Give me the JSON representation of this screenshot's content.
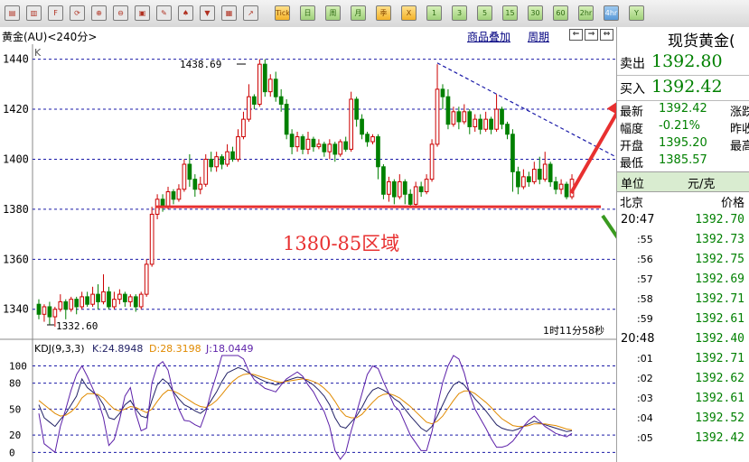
{
  "toolbar": {
    "icons": [
      "chart-icon",
      "book-icon",
      "f10-icon",
      "refresh-icon",
      "zoom-in-icon",
      "zoom-out-icon",
      "window-icon",
      "pen-icon",
      "indicator-icon",
      "filter-icon",
      "table-icon",
      "analysis-icon"
    ],
    "periods": [
      "Tick",
      "日",
      "周",
      "月",
      "季",
      "X",
      "1",
      "3",
      "5",
      "15",
      "30",
      "60",
      "2hr",
      "4hr",
      "Y"
    ],
    "active_period": "4hr"
  },
  "header": {
    "symbol_title": "黄金(AU)<240分>",
    "overlay_link": "商品叠加",
    "period_link": "周期"
  },
  "panel": {
    "title": "现货黄金(",
    "sell_label": "卖出",
    "sell_value": "1392.80",
    "buy_label": "买入",
    "buy_value": "1392.42",
    "stats": [
      {
        "label": "最新",
        "value": "1392.42",
        "label2": "涨跌"
      },
      {
        "label": "幅度",
        "value": "-0.21%",
        "label2": "昨收"
      },
      {
        "label": "开盘",
        "value": "1395.20",
        "label2": "最高"
      },
      {
        "label": "最低",
        "value": "1385.57",
        "label2": ""
      }
    ],
    "unit_label": "单位",
    "unit_value": "元/克",
    "col_city": "北京",
    "col_price": "价格",
    "ticks": [
      {
        "time": "20:47",
        "price": "1392.70"
      },
      {
        "time": ":55",
        "price": "1392.73"
      },
      {
        "time": ":56",
        "price": "1392.75"
      },
      {
        "time": ":57",
        "price": "1392.69"
      },
      {
        "time": ":58",
        "price": "1392.71"
      },
      {
        "time": ":59",
        "price": "1392.61"
      },
      {
        "time": "20:48",
        "price": "1392.40"
      },
      {
        "time": ":01",
        "price": "1392.71"
      },
      {
        "time": ":02",
        "price": "1392.62"
      },
      {
        "time": ":03",
        "price": "1392.61"
      },
      {
        "time": ":04",
        "price": "1392.52"
      },
      {
        "time": ":05",
        "price": "1392.42"
      }
    ]
  },
  "colors": {
    "up": "#cc0000",
    "down": "#008000",
    "support_line": "#e83030",
    "arrow_red": "#e83030",
    "arrow_green": "#3a9a20",
    "k_line": "#222266",
    "d_line": "#e08a00",
    "j_line": "#5b1fa8",
    "gridline": "#1a1aa8"
  },
  "chart_data": [
    {
      "type": "candlestick",
      "title": "黄金(AU)<240分>",
      "y_axis_label": "K",
      "ylim": [
        1328,
        1446
      ],
      "yticks": [
        1340,
        1360,
        1380,
        1400,
        1420,
        1440
      ],
      "max_label": "1438.69",
      "min_label": "1332.60",
      "countdown": "1时11分58秒",
      "annotation": "1380-85区域",
      "support_level": 1381,
      "trendline": {
        "start": [
          74,
          1438.5
        ],
        "end": [
          108,
          1400
        ]
      },
      "x_count": 100,
      "candles": [
        [
          1342,
          1338,
          1344,
          1336
        ],
        [
          1338,
          1341,
          1342,
          1335
        ],
        [
          1341,
          1337,
          1343,
          1334
        ],
        [
          1337,
          1340,
          1341,
          1333
        ],
        [
          1340,
          1343,
          1346,
          1339
        ],
        [
          1343,
          1340,
          1344,
          1336
        ],
        [
          1340,
          1344,
          1345,
          1339
        ],
        [
          1344,
          1341,
          1345,
          1338
        ],
        [
          1341,
          1345,
          1347,
          1340
        ],
        [
          1345,
          1342,
          1347,
          1341
        ],
        [
          1342,
          1346,
          1349,
          1341
        ],
        [
          1346,
          1343,
          1350,
          1340
        ],
        [
          1343,
          1347,
          1354,
          1342
        ],
        [
          1347,
          1341,
          1349,
          1340
        ],
        [
          1341,
          1344,
          1347,
          1340
        ],
        [
          1344,
          1346,
          1348,
          1342
        ],
        [
          1346,
          1343,
          1347,
          1341
        ],
        [
          1343,
          1345,
          1346,
          1341
        ],
        [
          1345,
          1341,
          1346,
          1339
        ],
        [
          1341,
          1346,
          1347,
          1340
        ],
        [
          1346,
          1358,
          1360,
          1345
        ],
        [
          1358,
          1378,
          1381,
          1357
        ],
        [
          1378,
          1384,
          1386,
          1376
        ],
        [
          1384,
          1381,
          1386,
          1379
        ],
        [
          1381,
          1387,
          1389,
          1380
        ],
        [
          1387,
          1384,
          1388,
          1382
        ],
        [
          1384,
          1388,
          1390,
          1383
        ],
        [
          1388,
          1398,
          1400,
          1387
        ],
        [
          1398,
          1392,
          1402,
          1389
        ],
        [
          1392,
          1388,
          1394,
          1385
        ],
        [
          1388,
          1390,
          1393,
          1386
        ],
        [
          1390,
          1400,
          1402,
          1389
        ],
        [
          1400,
          1397,
          1403,
          1395
        ],
        [
          1397,
          1401,
          1403,
          1395
        ],
        [
          1401,
          1398,
          1402,
          1396
        ],
        [
          1398,
          1403,
          1406,
          1397
        ],
        [
          1403,
          1400,
          1405,
          1399
        ],
        [
          1400,
          1409,
          1412,
          1399
        ],
        [
          1409,
          1416,
          1419,
          1408
        ],
        [
          1416,
          1425,
          1430,
          1415
        ],
        [
          1425,
          1422,
          1426,
          1420
        ],
        [
          1422,
          1438,
          1440,
          1421
        ],
        [
          1438,
          1427,
          1440,
          1425
        ],
        [
          1427,
          1432,
          1434,
          1425
        ],
        [
          1432,
          1425,
          1435,
          1423
        ],
        [
          1425,
          1422,
          1428,
          1419
        ],
        [
          1422,
          1410,
          1424,
          1408
        ],
        [
          1410,
          1405,
          1412,
          1402
        ],
        [
          1405,
          1409,
          1411,
          1403
        ],
        [
          1409,
          1404,
          1410,
          1402
        ],
        [
          1404,
          1408,
          1411,
          1402
        ],
        [
          1408,
          1405,
          1409,
          1403
        ],
        [
          1405,
          1406,
          1408,
          1404
        ],
        [
          1406,
          1403,
          1407,
          1401
        ],
        [
          1403,
          1406,
          1408,
          1400
        ],
        [
          1406,
          1402,
          1407,
          1399
        ],
        [
          1402,
          1407,
          1408,
          1401
        ],
        [
          1407,
          1404,
          1409,
          1403
        ],
        [
          1404,
          1424,
          1427,
          1403
        ],
        [
          1424,
          1416,
          1425,
          1413
        ],
        [
          1416,
          1410,
          1418,
          1408
        ],
        [
          1410,
          1407,
          1411,
          1405
        ],
        [
          1407,
          1409,
          1410,
          1406
        ],
        [
          1409,
          1397,
          1410,
          1392
        ],
        [
          1397,
          1386,
          1398,
          1384
        ],
        [
          1386,
          1391,
          1393,
          1383
        ],
        [
          1391,
          1385,
          1392,
          1382
        ],
        [
          1385,
          1391,
          1394,
          1384
        ],
        [
          1391,
          1386,
          1392,
          1382
        ],
        [
          1386,
          1382,
          1388,
          1381
        ],
        [
          1382,
          1389,
          1391,
          1381
        ],
        [
          1389,
          1387,
          1391,
          1385
        ],
        [
          1387,
          1392,
          1394,
          1386
        ],
        [
          1392,
          1406,
          1408,
          1391
        ],
        [
          1406,
          1428,
          1438,
          1405
        ],
        [
          1428,
          1425,
          1430,
          1420
        ],
        [
          1425,
          1414,
          1428,
          1412
        ],
        [
          1414,
          1419,
          1421,
          1413
        ],
        [
          1419,
          1415,
          1421,
          1412
        ],
        [
          1415,
          1419,
          1422,
          1414
        ],
        [
          1419,
          1413,
          1420,
          1410
        ],
        [
          1413,
          1416,
          1418,
          1411
        ],
        [
          1416,
          1412,
          1418,
          1410
        ],
        [
          1412,
          1416,
          1419,
          1411
        ],
        [
          1416,
          1412,
          1417,
          1410
        ],
        [
          1412,
          1420,
          1426,
          1411
        ],
        [
          1420,
          1414,
          1421,
          1412
        ],
        [
          1414,
          1410,
          1415,
          1408
        ],
        [
          1410,
          1395,
          1412,
          1387
        ],
        [
          1395,
          1389,
          1397,
          1386
        ],
        [
          1389,
          1393,
          1396,
          1388
        ],
        [
          1393,
          1391,
          1395,
          1389
        ],
        [
          1391,
          1396,
          1399,
          1390
        ],
        [
          1396,
          1392,
          1401,
          1390
        ],
        [
          1392,
          1398,
          1403,
          1391
        ],
        [
          1398,
          1391,
          1399,
          1389
        ],
        [
          1391,
          1388,
          1393,
          1386
        ],
        [
          1388,
          1390,
          1392,
          1386
        ],
        [
          1390,
          1385,
          1391,
          1384
        ],
        [
          1385,
          1392,
          1394,
          1384
        ]
      ]
    },
    {
      "type": "line",
      "title": "KDJ(9,3,3)",
      "ylim": [
        -8,
        112
      ],
      "yticks": [
        0,
        20,
        50,
        80,
        100
      ],
      "x_count": 100,
      "series": [
        {
          "name": "K",
          "last_value": "24.8948",
          "values": [
            55,
            40,
            35,
            30,
            38,
            45,
            55,
            65,
            85,
            75,
            70,
            65,
            55,
            40,
            38,
            45,
            55,
            60,
            50,
            42,
            40,
            60,
            78,
            85,
            80,
            70,
            62,
            55,
            52,
            48,
            45,
            50,
            60,
            70,
            82,
            92,
            95,
            98,
            96,
            92,
            88,
            85,
            82,
            80,
            78,
            80,
            83,
            85,
            87,
            86,
            82,
            78,
            72,
            65,
            55,
            40,
            30,
            28,
            35,
            42,
            52,
            64,
            72,
            75,
            72,
            68,
            62,
            58,
            50,
            42,
            35,
            28,
            24,
            30,
            42,
            55,
            68,
            78,
            82,
            78,
            70,
            62,
            55,
            48,
            40,
            32,
            28,
            26,
            25,
            27,
            30,
            33,
            36,
            34,
            32,
            30,
            28,
            26,
            24,
            25
          ]
        },
        {
          "name": "D",
          "last_value": "28.3198",
          "values": [
            60,
            55,
            50,
            45,
            42,
            43,
            47,
            53,
            63,
            68,
            68,
            67,
            63,
            56,
            50,
            48,
            50,
            53,
            52,
            49,
            46,
            50,
            59,
            67,
            72,
            71,
            68,
            64,
            60,
            56,
            53,
            52,
            55,
            60,
            67,
            75,
            82,
            87,
            90,
            91,
            90,
            88,
            86,
            84,
            82,
            81,
            82,
            83,
            84,
            85,
            84,
            82,
            79,
            74,
            68,
            59,
            49,
            42,
            40,
            40,
            44,
            51,
            58,
            64,
            67,
            68,
            66,
            63,
            58,
            53,
            47,
            41,
            35,
            33,
            36,
            42,
            51,
            60,
            68,
            71,
            71,
            68,
            63,
            58,
            52,
            45,
            39,
            35,
            31,
            30,
            30,
            31,
            33,
            33,
            33,
            32,
            31,
            29,
            27,
            26
          ]
        },
        {
          "name": "J",
          "last_value": "18.0449",
          "values": [
            45,
            10,
            5,
            0,
            30,
            50,
            72,
            90,
            100,
            88,
            74,
            60,
            40,
            8,
            15,
            38,
            65,
            75,
            45,
            25,
            28,
            80,
            100,
            105,
            95,
            68,
            50,
            37,
            36,
            32,
            29,
            46,
            70,
            90,
            112,
            112,
            112,
            112,
            108,
            94,
            84,
            79,
            74,
            72,
            70,
            78,
            85,
            89,
            93,
            88,
            78,
            70,
            58,
            47,
            30,
            2,
            -8,
            0,
            25,
            46,
            68,
            90,
            100,
            97,
            82,
            68,
            54,
            48,
            34,
            20,
            11,
            2,
            2,
            24,
            54,
            81,
            100,
            112,
            108,
            92,
            68,
            50,
            39,
            28,
            16,
            6,
            6,
            8,
            13,
            21,
            30,
            37,
            42,
            36,
            30,
            26,
            22,
            20,
            18,
            22
          ]
        }
      ]
    }
  ]
}
